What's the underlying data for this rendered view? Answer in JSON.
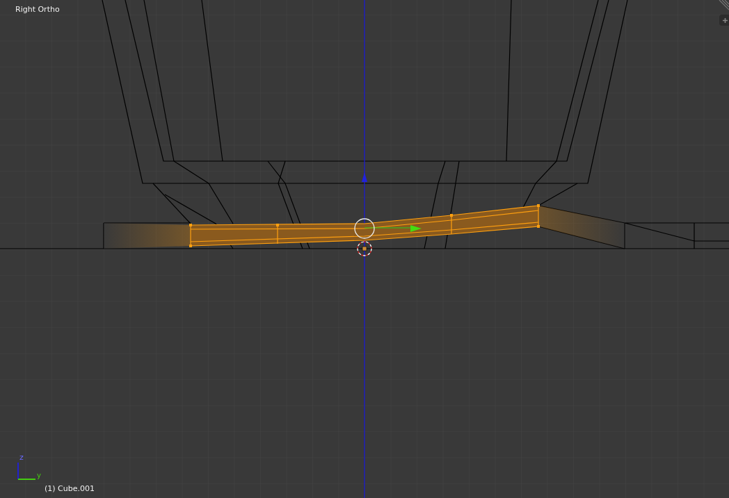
{
  "viewport": {
    "view_name": "Right Ortho",
    "object_info": "(1) Cube.001"
  },
  "axis_gizmo": {
    "vertical_label": "z",
    "horizontal_label": "y"
  }
}
